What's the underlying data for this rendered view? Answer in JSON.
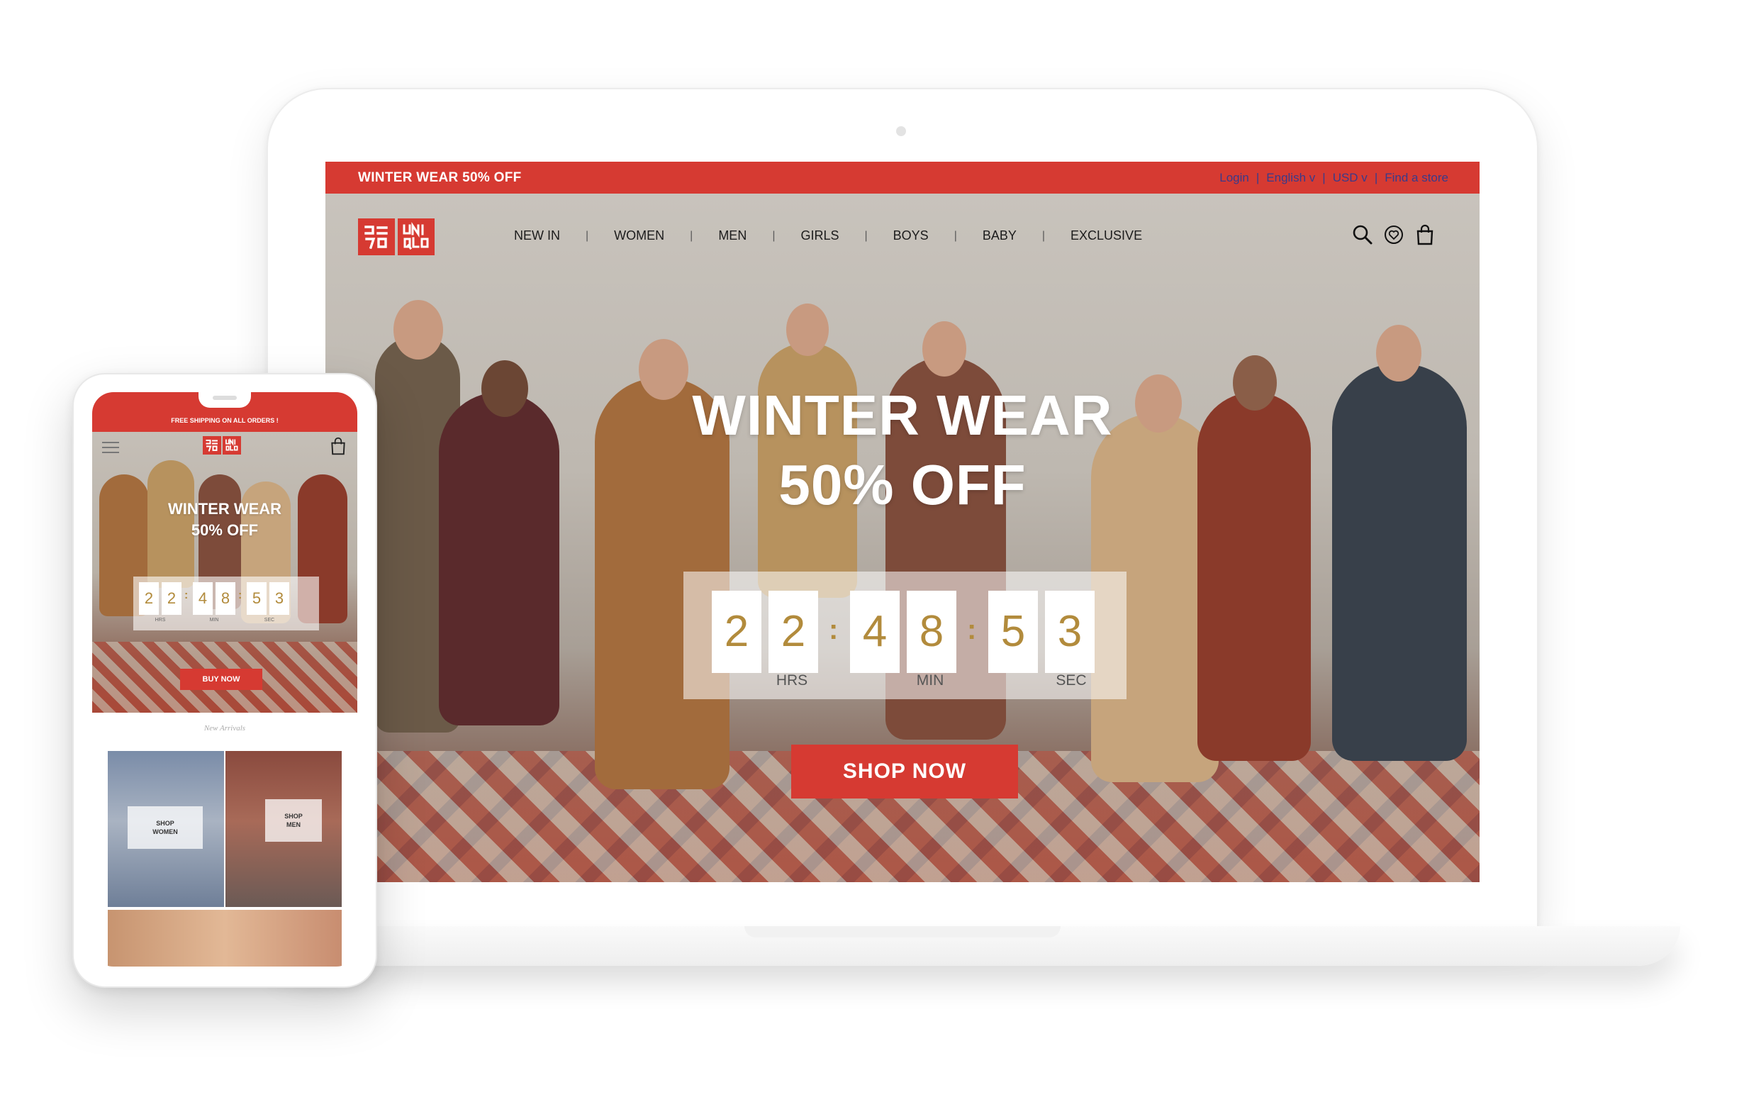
{
  "desktop": {
    "promo_text": "WINTER WEAR 50% OFF",
    "top_links": [
      "Login",
      "English v",
      "USD  v",
      "Find a store"
    ],
    "logo": {
      "top": "ユニ\nクロ",
      "bottom": "UNI\nQLO"
    },
    "nav": [
      "NEW IN",
      "WOMEN",
      "MEN",
      "GIRLS",
      "BOYS",
      "BABY",
      "EXCLUSIVE"
    ],
    "icons": [
      "search-icon",
      "heart-icon",
      "bag-icon"
    ],
    "hero_title_line1": "WINTER WEAR",
    "hero_title_line2": "50% OFF",
    "countdown": {
      "digits": [
        "2",
        "2",
        "4",
        "8",
        "5",
        "3"
      ],
      "separator": ":",
      "units": [
        "HRS",
        "MIN",
        "SEC"
      ]
    },
    "cta": "SHOP NOW"
  },
  "mobile": {
    "promo_text": "FREE SHIPPING ON ALL ORDERS !",
    "logo": {
      "top": "ユニ\nクロ",
      "bottom": "UNI\nQLO"
    },
    "hero_title_line1": "WINTER WEAR",
    "hero_title_line2": "50% OFF",
    "countdown": {
      "digits": [
        "2",
        "2",
        "4",
        "8",
        "5",
        "3"
      ],
      "separator": ":",
      "units": [
        "HRS",
        "MIN",
        "SEC"
      ]
    },
    "cta": "BUY NOW",
    "section_title": "New Arrivals",
    "tiles": [
      {
        "label_line1": "SHOP",
        "label_line2": "WOMEN"
      },
      {
        "label_line1": "SHOP",
        "label_line2": "MEN"
      }
    ]
  },
  "colors": {
    "brand_red": "#d63a32",
    "countdown_gold": "#b28b3c",
    "link_blue": "#3a3a8a"
  }
}
